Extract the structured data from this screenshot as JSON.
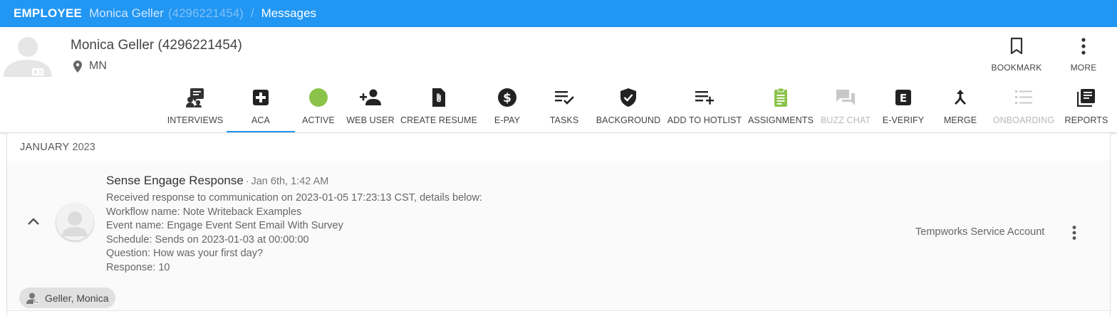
{
  "topbar": {
    "type_label": "EMPLOYEE",
    "name": "Monica Geller",
    "id": "(4296221454)",
    "separator": "/",
    "section": "Messages"
  },
  "header": {
    "employee_name": "Monica Geller (4296221454)",
    "location": "MN",
    "actions": [
      {
        "label": "BOOKMARK",
        "icon": "bookmark-icon"
      },
      {
        "label": "MORE",
        "icon": "more-vertical-icon"
      }
    ]
  },
  "toolbar": {
    "items": [
      {
        "label": "INTERVIEWS",
        "icon": "interviews-icon"
      },
      {
        "label": "ACA",
        "icon": "medical-plus-icon",
        "selected": true
      },
      {
        "label": "ACTIVE",
        "icon": "status-dot-icon",
        "color": "#8bc34a"
      },
      {
        "label": "WEB USER",
        "icon": "add-user-icon"
      },
      {
        "label": "CREATE RESUME",
        "icon": "resume-file-icon"
      },
      {
        "label": "E-PAY",
        "icon": "dollar-icon"
      },
      {
        "label": "TASKS",
        "icon": "tasks-icon"
      },
      {
        "label": "BACKGROUND",
        "icon": "shield-check-icon"
      },
      {
        "label": "ADD TO HOTLIST",
        "icon": "playlist-add-icon"
      },
      {
        "label": "ASSIGNMENTS",
        "icon": "clipboard-icon",
        "color": "#8bc34a"
      },
      {
        "label": "BUZZ CHAT",
        "icon": "chat-icon",
        "disabled": true
      },
      {
        "label": "E-VERIFY",
        "icon": "e-verify-icon"
      },
      {
        "label": "MERGE",
        "icon": "merge-icon"
      },
      {
        "label": "ONBOARDING",
        "icon": "checklist-icon",
        "disabled": true
      },
      {
        "label": "REPORTS",
        "icon": "reports-icon"
      }
    ]
  },
  "timeline": {
    "month": "JANUARY",
    "year": "2023",
    "message": {
      "title": "Sense Engage Response",
      "dot": "·",
      "time": "Jan 6th, 1:42 AM",
      "lines": [
        "Received response to communication on 2023-01-05 17:23:13 CST, details below:",
        "Workflow name: Note Writeback Examples",
        "Event name: Engage Event Sent Email With Survey",
        "Schedule: Sends on 2023-01-03 at 00:00:00",
        "Question: How was your first day?",
        "Response: 10"
      ],
      "account": "Tempworks Service Account",
      "chip": "Geller, Monica"
    }
  },
  "colors": {
    "topbar": "#2196f3",
    "accent": "#2196f3",
    "active_green": "#8bc34a"
  }
}
